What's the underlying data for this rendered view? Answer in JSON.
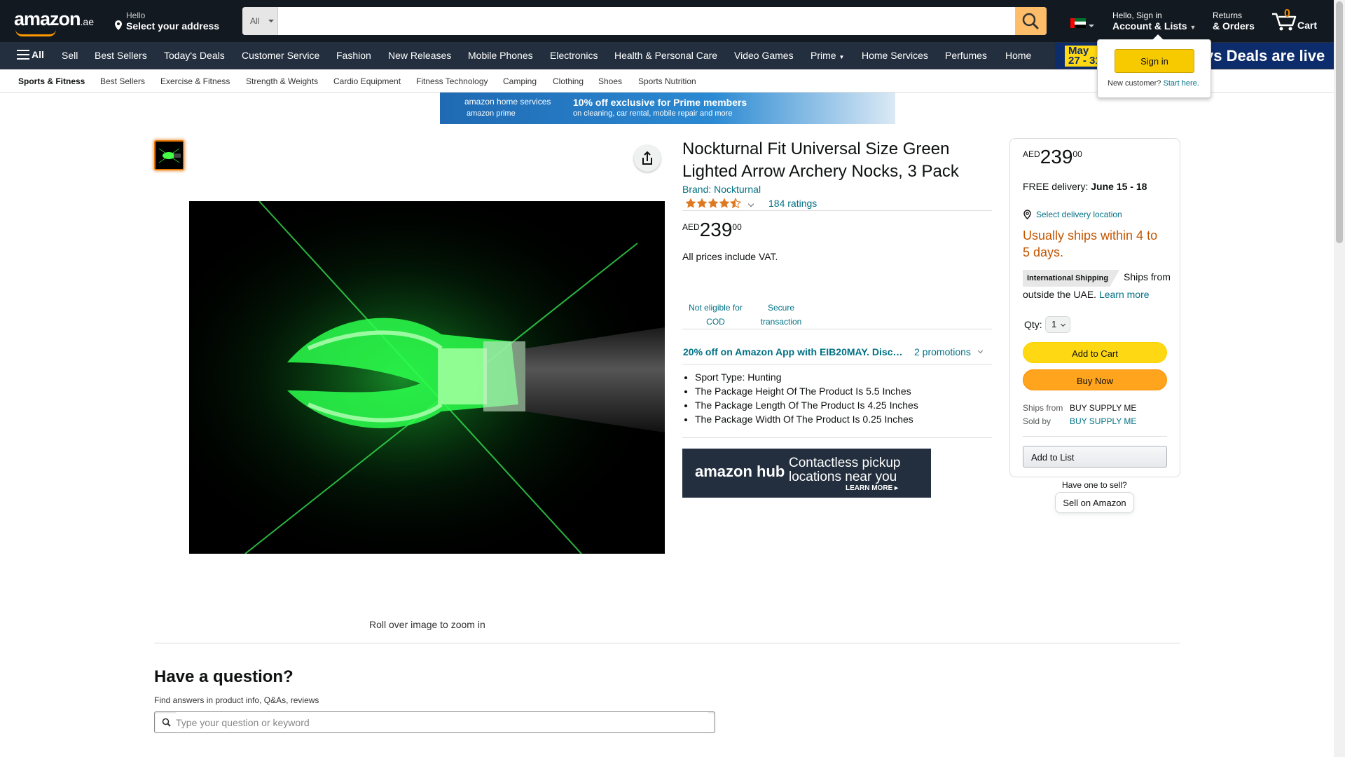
{
  "nav": {
    "logo": "amazon",
    "logo_tld": ".ae",
    "address_hello": "Hello",
    "address_select": "Select your address",
    "search_category": "All",
    "search_placeholder": "",
    "account_hello": "Hello, Sign in",
    "account_lists": "Account & Lists",
    "returns_line1": "Returns",
    "returns_line2": "& Orders",
    "cart_count": "0",
    "cart_label": "Cart"
  },
  "main_nav": {
    "all_label": "All",
    "items": [
      "Sell",
      "Best Sellers",
      "Today's Deals",
      "Customer Service",
      "Fashion",
      "New Releases",
      "Mobile Phones",
      "Electronics",
      "Health & Personal Care",
      "Video Games",
      "Prime",
      "Home Services",
      "Perfumes",
      "Home"
    ],
    "promo_date_1": "May",
    "promo_date_2": "27 - 31",
    "promo_text": "ys  Deals are live"
  },
  "sub_nav": {
    "items": [
      "Sports & Fitness",
      "Best Sellers",
      "Exercise & Fitness",
      "Strength & Weights",
      "Cardio Equipment",
      "Fitness Technology",
      "Camping",
      "Clothing",
      "Shoes",
      "Sports Nutrition"
    ]
  },
  "flyout": {
    "sign_in": "Sign in",
    "new_customer": "New customer?",
    "start_here": "Start here."
  },
  "banner": {
    "brand1": "amazon home services",
    "brand2": "amazon prime",
    "headline": "10% off exclusive for Prime members",
    "sub": "on cleaning, car rental, mobile repair and more"
  },
  "product": {
    "title": "Nockturnal Fit Universal Size Green Lighted Arrow Archery Nocks, 3 Pack",
    "brand": "Brand: Nockturnal",
    "rating": 4.5,
    "ratings_count": "184 ratings",
    "price_currency": "AED",
    "price_whole": "239",
    "price_fraction": "00",
    "vat_note": "All prices include VAT.",
    "badge_cod_1": "Not eligible for",
    "badge_cod_2": "COD",
    "badge_secure_1": "Secure",
    "badge_secure_2": "transaction",
    "promo_text": "20% off on Amazon App with EIB20MAY. Discount",
    "promo_count": "2 promotions",
    "bullets": [
      "Sport Type: Hunting",
      "The Package Height Of The Product Is 5.5 Inches",
      "The Package Length Of The Product Is 4.25 Inches",
      "The Package Width Of The Product Is 0.25 Inches"
    ],
    "zoom_hint": "Roll over image to zoom in"
  },
  "hub_ad": {
    "logo": "amazon hub",
    "line1": "Contactless pickup",
    "line2": "locations near you",
    "cta": "LEARN MORE ▸"
  },
  "buybox": {
    "price_currency": "AED",
    "price_whole": "239",
    "price_fraction": "00",
    "delivery_prefix": "FREE delivery:",
    "delivery_dates": "June 15 - 18",
    "select_location": "Select delivery location",
    "stock": "Usually ships within 4 to 5 days.",
    "intl_tag": "International Shipping",
    "intl_text": "Ships from outside the UAE.",
    "learn_more": "Learn more",
    "qty_label": "Qty:",
    "qty_value": "1",
    "add_to_cart": "Add to Cart",
    "buy_now": "Buy Now",
    "ships_from_label": "Ships from",
    "ships_from_value": "BUY SUPPLY ME",
    "sold_by_label": "Sold by",
    "sold_by_value": "BUY SUPPLY ME",
    "add_to_list": "Add to List",
    "have_one": "Have one to sell?",
    "sell_on_amazon": "Sell on Amazon"
  },
  "qa": {
    "title": "Have a question?",
    "subtitle": "Find answers in product info, Q&As, reviews",
    "placeholder": "Type your question or keyword"
  },
  "colors": {
    "nav_dark": "#131921",
    "nav_secondary": "#232f3e",
    "accent_orange": "#ff9900",
    "link": "#007185",
    "stock_orange": "#c45500",
    "cart_yellow": "#ffd814",
    "buy_orange": "#ffa41c"
  }
}
